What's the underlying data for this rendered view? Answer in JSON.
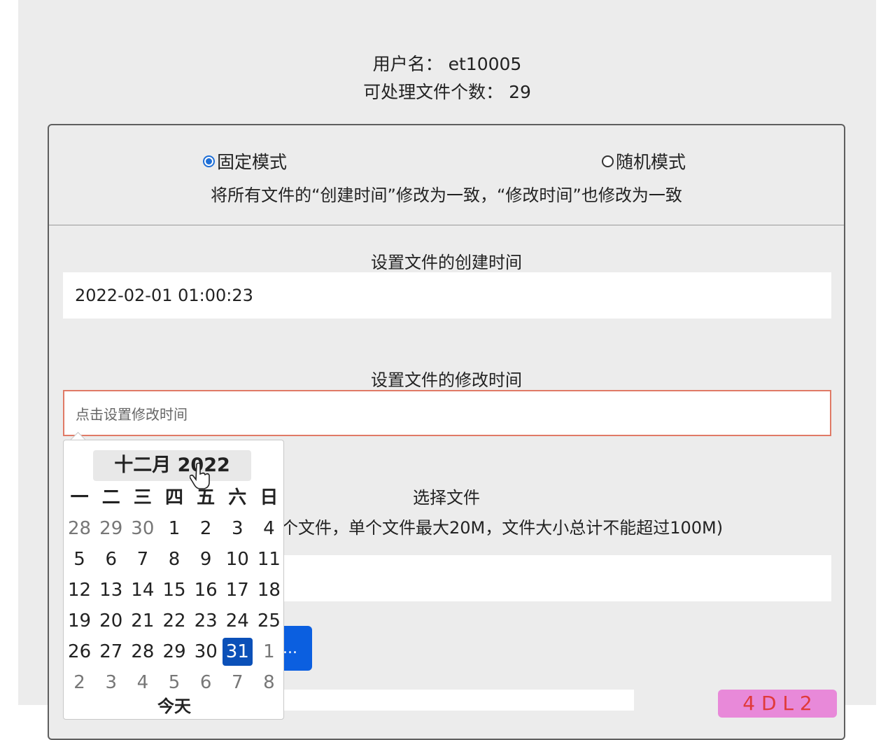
{
  "header": {
    "username_label": "用户名：",
    "username": "et10005",
    "count_label": "可处理文件个数：",
    "count": "29"
  },
  "modes": {
    "fixed_label": "固定模式",
    "random_label": "随机模式",
    "selected": "fixed",
    "description": "将所有文件的“创建时间”修改为一致，“修改时间”也修改为一致"
  },
  "create_time": {
    "label": "设置文件的创建时间",
    "value": "2022-02-01 01:00:23"
  },
  "modify_time": {
    "label": "设置文件的修改时间",
    "placeholder": "点击设置修改时间"
  },
  "file_select": {
    "label": "选择文件",
    "hint": "个文件，单个文件最大20M，文件大小总计不能超过100M)",
    "button_label": "..."
  },
  "badge": {
    "text": "4 D L 2"
  },
  "calendar": {
    "title": "十二月 2022",
    "weekdays": [
      "一",
      "二",
      "三",
      "四",
      "五",
      "六",
      "日"
    ],
    "weeks": [
      [
        "28",
        "29",
        "30",
        "1",
        "2",
        "3",
        "4"
      ],
      [
        "5",
        "6",
        "7",
        "8",
        "9",
        "10",
        "11"
      ],
      [
        "12",
        "13",
        "14",
        "15",
        "16",
        "17",
        "18"
      ],
      [
        "19",
        "20",
        "21",
        "22",
        "23",
        "24",
        "25"
      ],
      [
        "26",
        "27",
        "28",
        "29",
        "30",
        "31",
        "1"
      ],
      [
        "2",
        "3",
        "4",
        "5",
        "6",
        "7",
        "8"
      ]
    ],
    "muted": [
      [
        0,
        0
      ],
      [
        0,
        1
      ],
      [
        0,
        2
      ],
      [
        4,
        6
      ],
      [
        5,
        0
      ],
      [
        5,
        1
      ],
      [
        5,
        2
      ],
      [
        5,
        3
      ],
      [
        5,
        4
      ],
      [
        5,
        5
      ],
      [
        5,
        6
      ]
    ],
    "selected": [
      4,
      5
    ],
    "footer": "今天"
  }
}
